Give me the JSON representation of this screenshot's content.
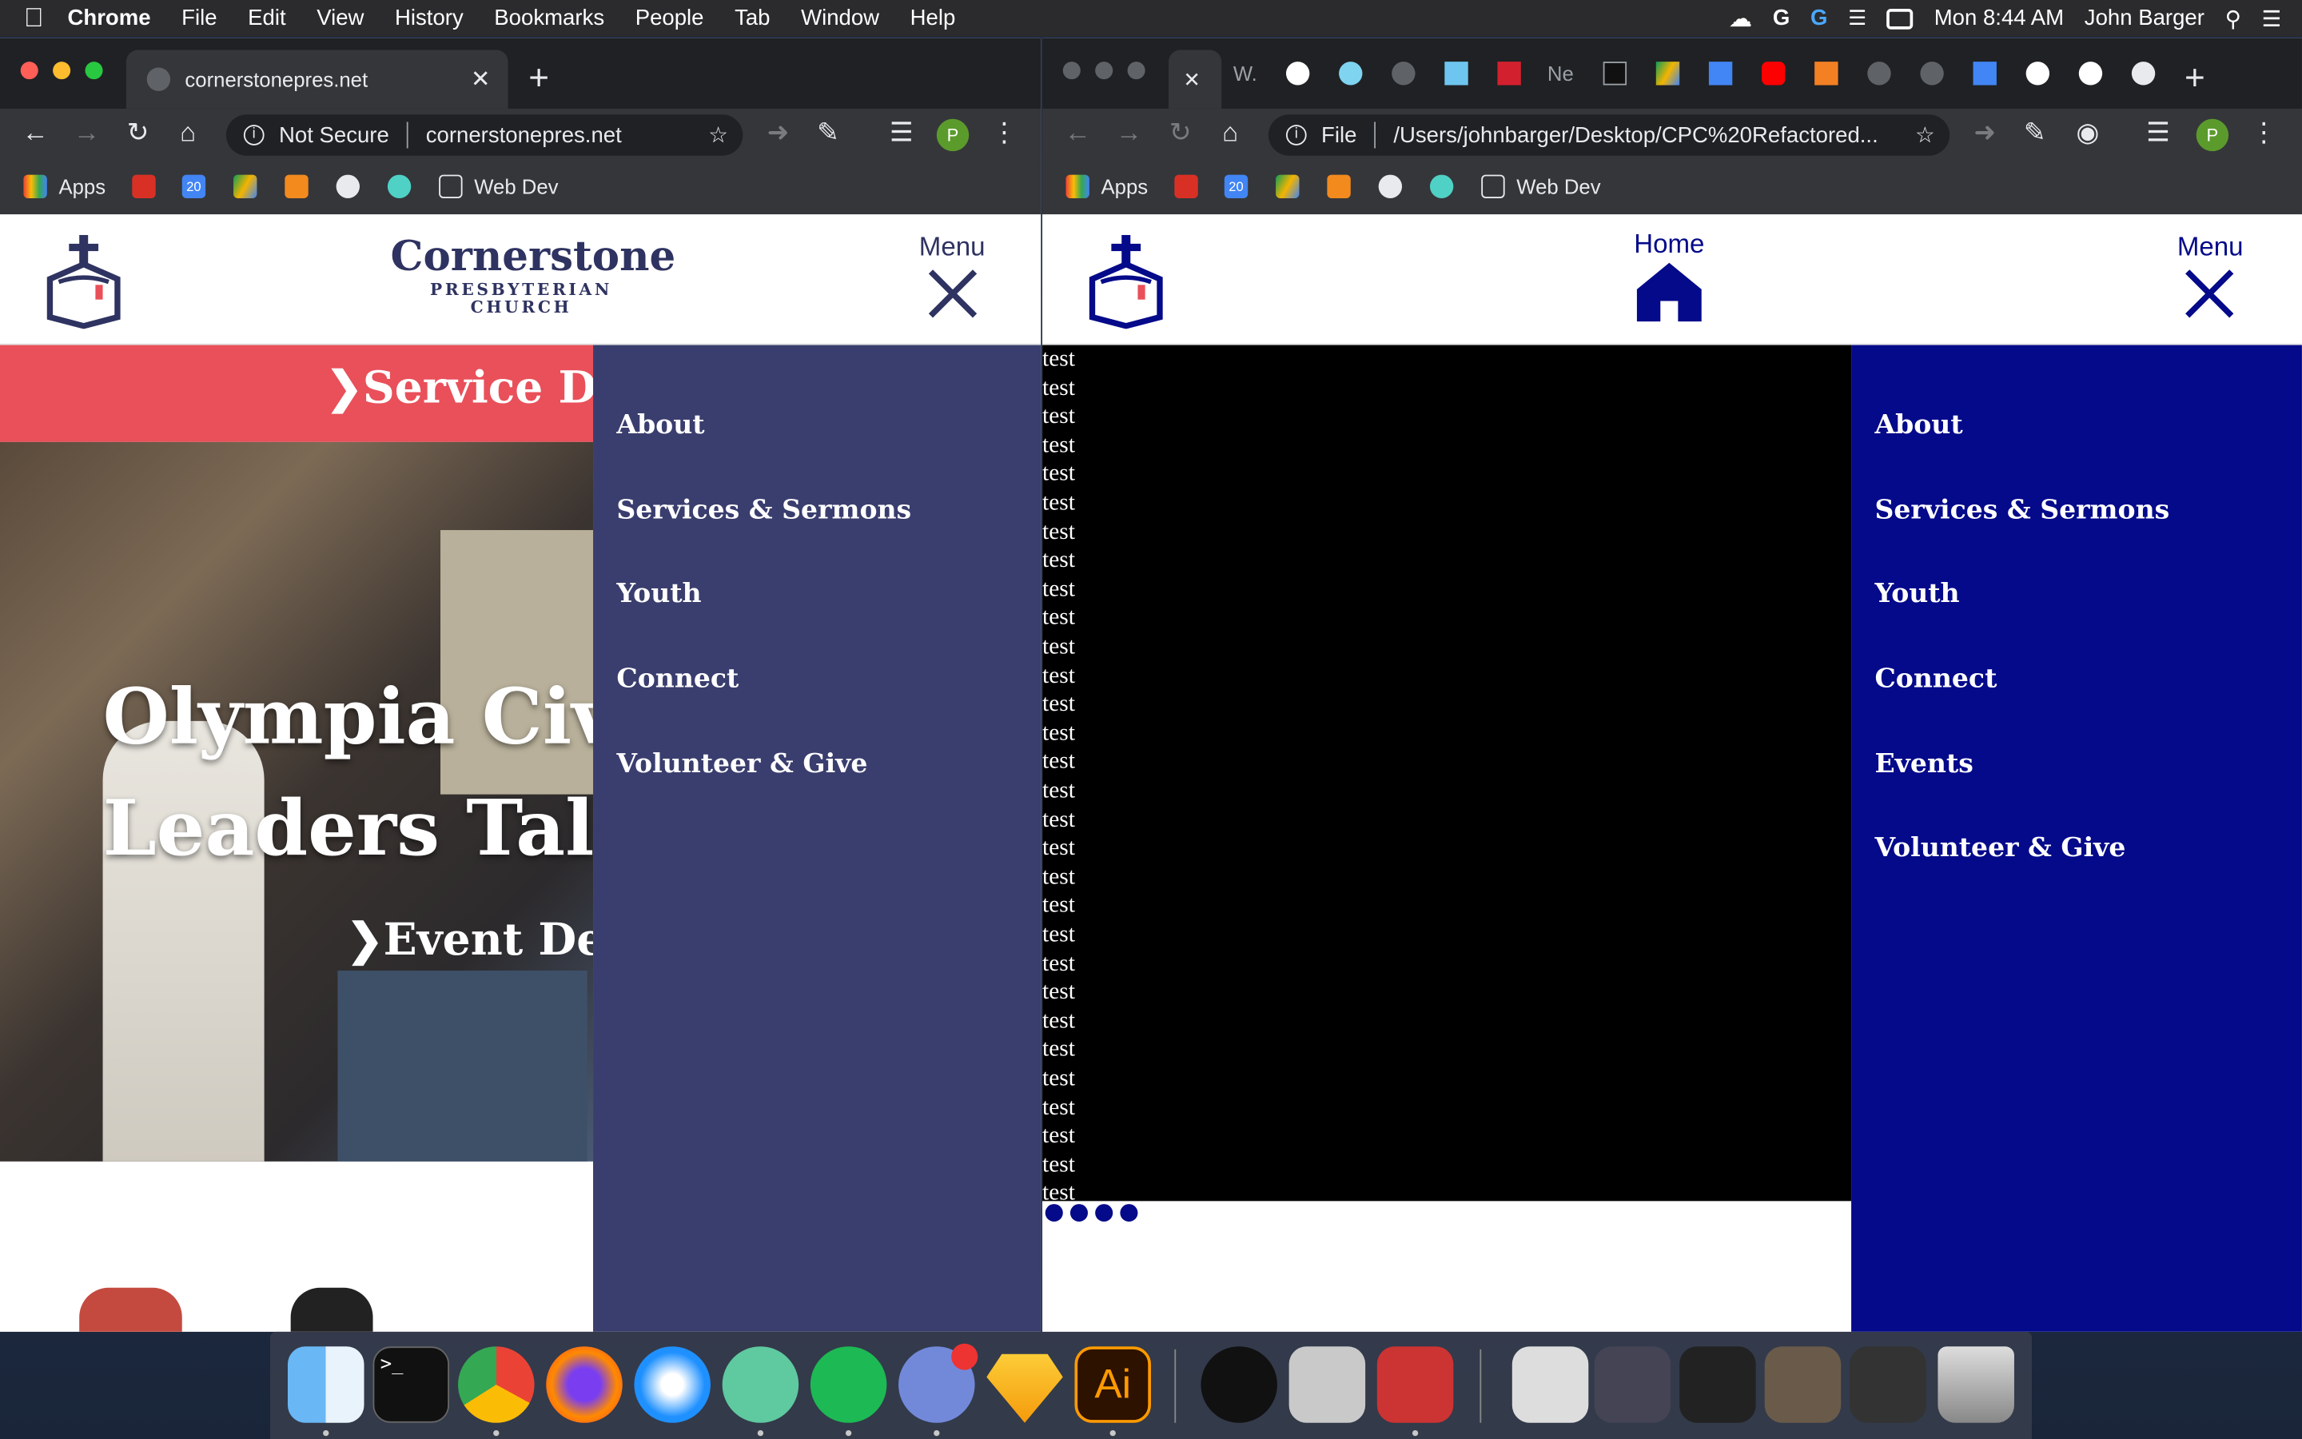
{
  "menubar": {
    "app": "Chrome",
    "items": [
      "File",
      "Edit",
      "View",
      "History",
      "Bookmarks",
      "People",
      "Tab",
      "Window",
      "Help"
    ],
    "clock": "Mon 8:44 AM",
    "user": "John Barger"
  },
  "left_window": {
    "tab_title": "cornerstonepres.net",
    "security": "Not Secure",
    "url": "cornerstonepres.net",
    "avatar_letter": "P",
    "bookmarks": [
      "Apps",
      "Web Dev"
    ],
    "calendar_badge": "20",
    "site": {
      "logo_name": "Cornerstone",
      "logo_sub1": "PRESBYTERIAN",
      "logo_sub2": "CHURCH",
      "menu_label": "Menu",
      "banner_text": "Service De",
      "hero_line1": "Olympia Civ",
      "hero_line2": "Leaders Tall",
      "hero_cta": "Event De",
      "nav": [
        "About",
        "Services & Sermons",
        "Youth",
        "Connect",
        "Volunteer & Give"
      ]
    }
  },
  "right_window": {
    "tab_label_partial": "Ne",
    "tab_label_w": "W.",
    "security": "File",
    "url": "/Users/johnbarger/Desktop/CPC%20Refactored...",
    "avatar_letter": "P",
    "bookmarks": [
      "Apps",
      "Web Dev"
    ],
    "calendar_badge": "20",
    "site": {
      "home_label": "Home",
      "menu_label": "Menu",
      "test_text": "test",
      "test_count": 30,
      "nav": [
        "About",
        "Services & Sermons",
        "Youth",
        "Connect",
        "Events",
        "Volunteer & Give"
      ]
    }
  },
  "dock": {
    "apps": [
      "finder",
      "terminal",
      "chrome",
      "firefox",
      "safari",
      "atom",
      "spotify",
      "discord",
      "sketch",
      "illustrator",
      "logitech",
      "fontforge",
      "photo-booth",
      "recent-1",
      "recent-2",
      "recent-3",
      "recent-4",
      "recent-5",
      "trash"
    ],
    "illustrator_label": "Ai",
    "terminal_prompt": ">_"
  },
  "colors": {
    "left_nav": "#3a3e6e",
    "right_nav": "#050a8a",
    "banner_red": "#e9505a",
    "brand_navy": "#2f3361"
  }
}
